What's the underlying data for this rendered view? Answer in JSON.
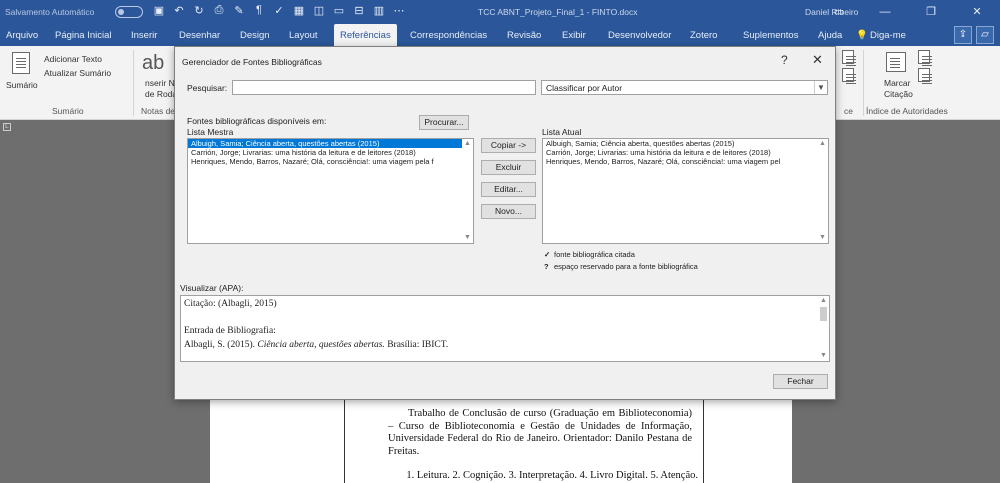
{
  "window": {
    "autosave_label": "Salvamento Automático",
    "doc_title": "TCC ABNT_Projeto_Final_1 - FINTO.docx",
    "user_name": "Daniel Ribeiro"
  },
  "menu": {
    "tabs": [
      "Arquivo",
      "Página Inicial",
      "Inserir",
      "Desenhar",
      "Design",
      "Layout",
      "Referências",
      "Correspondências",
      "Revisão",
      "Exibir",
      "Desenvolvedor",
      "Zotero",
      "Suplementos",
      "Ajuda"
    ],
    "active_tab": "Referências",
    "tell_me": "Diga-me"
  },
  "ribbon": {
    "sumario_btn": "Sumário",
    "add_text": "Adicionar Texto",
    "update_summary": "Atualizar Sumário",
    "group_sumario": "Sumário",
    "footnote_partial_1": "nserir N",
    "footnote_partial_2": "de Roda",
    "group_notes": "Notas de",
    "mark_citation_1": "Marcar",
    "mark_citation_2": "Citação",
    "group_authorities": "Índice de Autoridades",
    "group_partial": "ce"
  },
  "dialog": {
    "title": "Gerenciador de Fontes Bibliográficas",
    "help": "?",
    "close": "✕",
    "search_label": "Pesquisar:",
    "search_value": "",
    "sort_value": "Classificar por Autor",
    "sources_label_1": "Fontes bibliográficas disponíveis em:",
    "sources_label_2": "Lista Mestra",
    "browse_btn": "Procurar...",
    "current_list_label": "Lista Atual",
    "master_list": [
      "Albuigh, Samia; Ciência aberta, questões abertas (2015)",
      "Carrión, Jorge; Livrarias: uma história da leitura e de leitores (2018)",
      "Henriques, Mendo, Barros, Nazaré; Olá, consciência!: uma viagem pela f"
    ],
    "current_list": [
      "Albuigh, Samia; Ciência aberta, questões abertas (2015)",
      "Carrión, Jorge; Livrarias: uma história da leitura e de leitores (2018)",
      "Henriques, Mendo, Barros, Nazaré; Olá, consciência!: uma viagem pel"
    ],
    "copy_btn": "Copiar ->",
    "delete_btn": "Excluir",
    "edit_btn": "Editar...",
    "new_btn": "Novo...",
    "legend_cited": "fonte bibliográfica citada",
    "legend_placeholder": "espaço reservado para a fonte bibliográfica",
    "preview_label": "Visualizar (APA):",
    "preview_citation": "Citação: (Albagli, 2015)",
    "preview_entry_label": "Entrada de Bibliografia:",
    "preview_entry_author": "Albagli, S. (2015).",
    "preview_entry_title": "Ciência aberta, questões abertas.",
    "preview_entry_rest": "Brasília: IBICT.",
    "close_btn": "Fechar"
  },
  "document": {
    "body_text": "Trabalho de Conclusão de curso (Graduação em Biblioteconomia) – Curso de Biblioteconomia e Gestão de Unidades de Informação, Universidade Federal do Rio de Janeiro. Orientador: Danilo Pestana de Freitas.",
    "keywords": "1. Leitura. 2. Cognição. 3. Interpretação. 4. Livro Digital. 5. Atenção."
  }
}
